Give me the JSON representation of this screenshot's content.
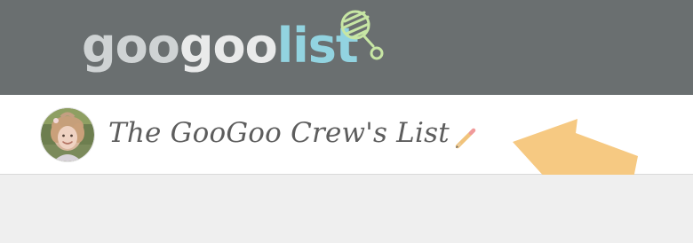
{
  "app": {
    "name": "googoolist",
    "logo_parts": [
      "goo",
      "goo",
      "list"
    ]
  },
  "list": {
    "title": "The GooGoo Crew's List"
  },
  "icons": {
    "logo_icon": "rattle-icon",
    "avatar": "avatar-photo",
    "edit": "pencil-icon",
    "callout": "arrow-callout"
  },
  "colors": {
    "header_bg": "#6a6f70",
    "logo_goo_1": "#cfd3d4",
    "logo_goo_2": "#e9eaea",
    "logo_list": "#92d3e0",
    "rattle_stroke": "#c7e6a4",
    "subbar_bg": "#ffffff",
    "title_text": "#5d5d5d",
    "pencil_accent": "#f1c37b",
    "arrow_fill": "#f6c982",
    "page_bg": "#efefef"
  }
}
